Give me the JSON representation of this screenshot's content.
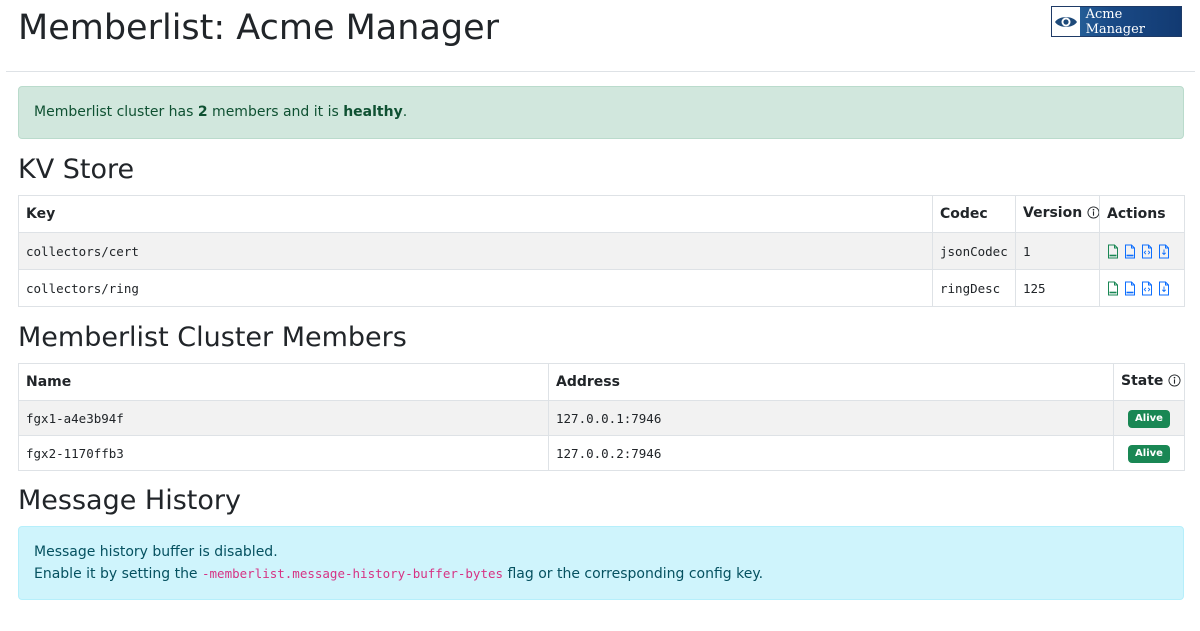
{
  "header": {
    "title": "Memberlist: Acme Manager",
    "logo_text": "Acme Manager",
    "logo_icon": "eye-icon"
  },
  "status_alert": {
    "prefix": "Memberlist cluster has ",
    "member_count": "2",
    "middle": " members and it is ",
    "health": "healthy",
    "suffix": "."
  },
  "kv_store": {
    "title": "KV Store",
    "columns": {
      "key": "Key",
      "codec": "Codec",
      "version": "Version",
      "actions": "Actions"
    },
    "rows": [
      {
        "key": "collectors/cert",
        "codec": "jsonCodec",
        "version": "1"
      },
      {
        "key": "collectors/ring",
        "codec": "ringDesc",
        "version": "125"
      }
    ],
    "action_icons": [
      "json-file-icon",
      "json-pretty-file-icon",
      "code-file-icon",
      "download-file-icon"
    ]
  },
  "members": {
    "title": "Memberlist Cluster Members",
    "columns": {
      "name": "Name",
      "address": "Address",
      "state": "State"
    },
    "rows": [
      {
        "name": "fgx1-a4e3b94f",
        "address": "127.0.0.1:7946",
        "state": "Alive"
      },
      {
        "name": "fgx2-1170ffb3",
        "address": "127.0.0.2:7946",
        "state": "Alive"
      }
    ]
  },
  "message_history": {
    "title": "Message History",
    "line1": "Message history buffer is disabled.",
    "line2_prefix": "Enable it by setting the ",
    "flag": "-memberlist.message-history-buffer-bytes",
    "line2_suffix": " flag or the corresponding config key."
  },
  "colors": {
    "success_bg": "#d1e7dd",
    "info_bg": "#cff4fc",
    "badge_alive": "#198754",
    "flag_text": "#d63384"
  }
}
